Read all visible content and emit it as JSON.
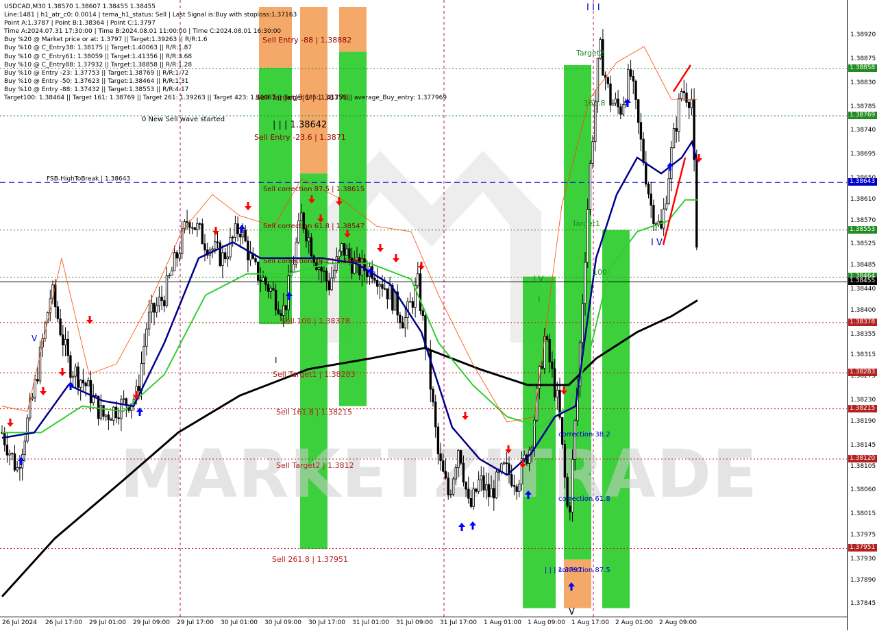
{
  "chart_data": {
    "type": "candlestick",
    "symbol": "USDCAD,M30",
    "ylim": [
      1.37835,
      1.38975
    ],
    "info_lines": [
      "USDCAD,M30  1.38570 1.38607 1.38455 1.38455",
      "Line:1481 | h1_atr_c0: 0.0014 | tema_h1_status: Sell | Last Signal is:Buy with stoploss:1.37163",
      "Point A:1.3787 | Point B:1.38364 | Point C:1.3797",
      "Time A:2024.07.31 17:30:00 | Time B:2024.08.01 11:00:00 | Time C:2024.08.01 16:30:00",
      "Buy %20 @ Market price or at: 1.3797 || Target:1.39263 || R/R:1.6",
      "Buy %10 @ C_Entry38: 1.38175 || Target:1.40063 || R/R:1.87",
      "Buy %10 @ C_Entry61: 1.38059 || Target:1.41356 || R/R:3.68",
      "Buy %10 @ C_Entry88: 1.37932 || Target:1.38858 || R/R:1.28",
      "Buy %10 @ Entry -23: 1.37753 || Target:1.38769 || R/R:1.72",
      "Buy %10 @ Entry -50: 1.37623 || Target:1.38464 || R/R:1.31",
      "Buy %10 @ Entry -88: 1.37432 || Target:1.38553 || R/R:4.17",
      "Target100: 1.38464 || Target 161: 1.38769 || Target 261: 1.39263 || Target 423: 1.40063 || Target 685: 1.41356 || average_Buy_entry: 1.377969"
    ],
    "status_text": "0 New Sell wave started",
    "y_ticks": [
      "1.38920",
      "1.38875",
      "1.38830",
      "1.38785",
      "1.38740",
      "1.38695",
      "1.38650",
      "1.38610",
      "1.38570",
      "1.38525",
      "1.38485",
      "1.38440",
      "1.38400",
      "1.38355",
      "1.38315",
      "1.38275",
      "1.38230",
      "1.38190",
      "1.38145",
      "1.38105",
      "1.38060",
      "1.38015",
      "1.37975",
      "1.37930",
      "1.37890",
      "1.37845"
    ],
    "x_ticks": [
      "26 Jul 2024",
      "26 Jul 17:00",
      "29 Jul 01:00",
      "29 Jul 09:00",
      "29 Jul 17:00",
      "30 Jul 01:00",
      "30 Jul 09:00",
      "30 Jul 17:00",
      "31 Jul 01:00",
      "31 Jul 09:00",
      "31 Jul 17:00",
      "1 Aug 01:00",
      "1 Aug 09:00",
      "1 Aug 17:00",
      "2 Aug 01:00",
      "2 Aug 09:00"
    ],
    "levels": [
      {
        "price": 1.38858,
        "label": "1.38858",
        "color": "#228B22",
        "style": "dotted"
      },
      {
        "price": 1.38769,
        "label": "1.38769",
        "color": "#228B22",
        "style": "dotted"
      },
      {
        "price": 1.38643,
        "label": "1.38643",
        "color": "#0000CD",
        "style": "dashed",
        "text": "FSB-HighToBreak | 1.38643"
      },
      {
        "price": 1.38553,
        "label": "1.38553",
        "color": "#228B22",
        "style": "dotted"
      },
      {
        "price": 1.38464,
        "label": "1.38464",
        "color": "#228B22",
        "style": "dotted"
      },
      {
        "price": 1.38455,
        "label": "1.38455",
        "color": "#000000",
        "style": "solid"
      },
      {
        "price": 1.38378,
        "label": "1.38378",
        "color": "#B22222",
        "style": "dotted"
      },
      {
        "price": 1.38283,
        "label": "1.38283",
        "color": "#B22222",
        "style": "dotted"
      },
      {
        "price": 1.38215,
        "label": "1.38215",
        "color": "#B22222",
        "style": "dotted"
      },
      {
        "price": 1.3812,
        "label": "1.38120",
        "color": "#B22222",
        "style": "dotted"
      },
      {
        "price": 1.37951,
        "label": "1.37951",
        "color": "#B22222",
        "style": "dotted"
      }
    ],
    "annotations": [
      {
        "text": "Sell Entry -88 | 1.38882",
        "color": "#8B0000"
      },
      {
        "text": "Sell Target(5|1 | 1.38778",
        "color": "#8B0000"
      },
      {
        "text": "| | | 1.38642",
        "color": "#000000"
      },
      {
        "text": "Sell Entry -23.6 | 1.3871",
        "color": "#8B0000"
      },
      {
        "text": "Sell correction 87.5 | 1.38615",
        "color": "#8B0000"
      },
      {
        "text": "Sell correction 61.8 | 1.38547",
        "color": "#8B0000"
      },
      {
        "text": "Sell correction 38.2 | 1.38467",
        "color": "#8B0000"
      },
      {
        "text": "Sell 100 | 1.38378",
        "color": "#B22222"
      },
      {
        "text": "Sell Target1 | 1.38283",
        "color": "#B22222"
      },
      {
        "text": "Sell 161.8 | 1.38215",
        "color": "#B22222"
      },
      {
        "text": "Sell Target2 | 1.3812",
        "color": "#B22222"
      },
      {
        "text": "Sell  261.8 | 1.37951",
        "color": "#B22222"
      },
      {
        "text": "Target2",
        "color": "#228B22"
      },
      {
        "text": "161.8",
        "color": "#228B22"
      },
      {
        "text": "Target1",
        "color": "#228B22"
      },
      {
        "text": "100",
        "color": "#228B22"
      },
      {
        "text": "correction 38.2",
        "color": "#0000CD"
      },
      {
        "text": "correction 61.8",
        "color": "#0000CD"
      },
      {
        "text": "correction 87.5",
        "color": "#0000CD"
      },
      {
        "text": "| | | 1.3797",
        "color": "#0000CD"
      },
      {
        "text": "I V",
        "color": "#228B22"
      },
      {
        "text": "I",
        "color": "#228B22"
      },
      {
        "text": "I V",
        "color": "#0000CD"
      },
      {
        "text": "V",
        "color": "#0000CD"
      },
      {
        "text": "V",
        "color": "#000000"
      },
      {
        "text": "I I I",
        "color": "#0000CD"
      },
      {
        "text": "I",
        "color": "#000000"
      }
    ],
    "watermark": "MARKETZITRADE",
    "colors": {
      "bull_candle": "#000000",
      "bear_candle": "#000000",
      "ma_fast": "#00008B",
      "ma_mid": "#32CD32",
      "ma_slow": "#000000",
      "sell_zone": "#F4A460",
      "buy_zone": "#32CD32",
      "signal_sell": "#FF0000",
      "signal_buy": "#0000FF"
    }
  }
}
